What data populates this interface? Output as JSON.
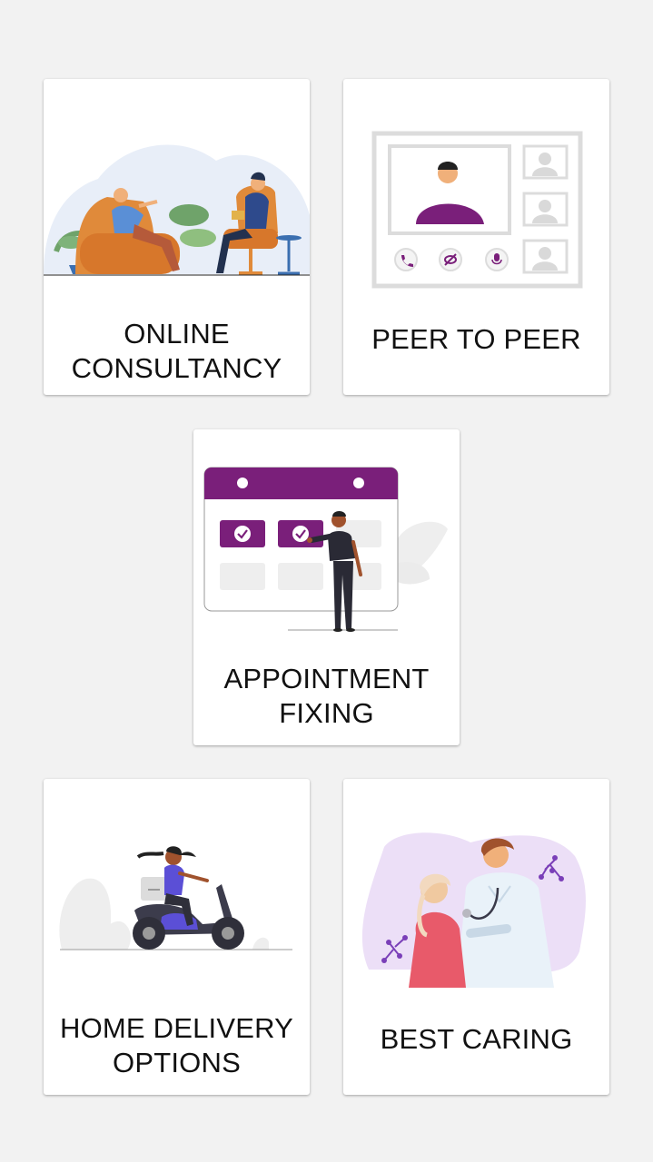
{
  "colors": {
    "background": "#f2f2f2",
    "card": "#ffffff",
    "accent_purple": "#7a1f7a",
    "text": "#111111"
  },
  "cards": {
    "online_consultancy": {
      "label_line1": "ONLINE",
      "label_line2": "CONSULTANCY",
      "illustration": "therapy-session-illustration"
    },
    "peer_to_peer": {
      "label": "PEER TO PEER",
      "illustration": "video-call-illustration"
    },
    "appointment_fixing": {
      "label_line1": "APPOINTMENT",
      "label_line2": "FIXING",
      "illustration": "calendar-booking-illustration"
    },
    "home_delivery": {
      "label_line1": "HOME DELIVERY",
      "label_line2": "OPTIONS",
      "illustration": "scooter-delivery-illustration"
    },
    "best_caring": {
      "label": "BEST CARING",
      "illustration": "doctor-patient-illustration"
    }
  }
}
